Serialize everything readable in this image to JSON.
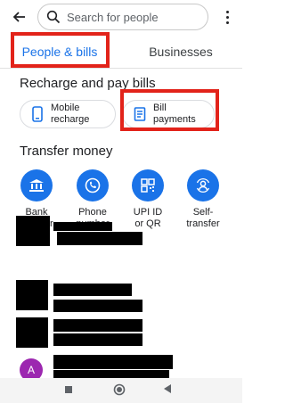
{
  "search": {
    "placeholder": "Search for people"
  },
  "tabs": [
    {
      "label": "People & bills",
      "selected": true
    },
    {
      "label": "Businesses",
      "selected": false
    }
  ],
  "recharge": {
    "title": "Recharge and pay bills",
    "chips": [
      {
        "label": "Mobile\nrecharge",
        "icon": "phone-icon"
      },
      {
        "label": "Bill\npayments",
        "icon": "receipt-icon"
      }
    ]
  },
  "transfer": {
    "title": "Transfer money",
    "items": [
      {
        "label": "Bank\ntransfer",
        "icon": "bank-icon"
      },
      {
        "label": "Phone\nnumber",
        "icon": "phone-call-icon"
      },
      {
        "label": "UPI ID\nor QR",
        "icon": "qr-code-icon"
      },
      {
        "label": "Self-\ntransfer",
        "icon": "self-transfer-icon"
      }
    ]
  },
  "contacts": {
    "last_avatar_initial": "A"
  },
  "colors": {
    "accent": "#1a73e8",
    "highlight": "#e2231a",
    "avatar": "#9c27b0"
  }
}
